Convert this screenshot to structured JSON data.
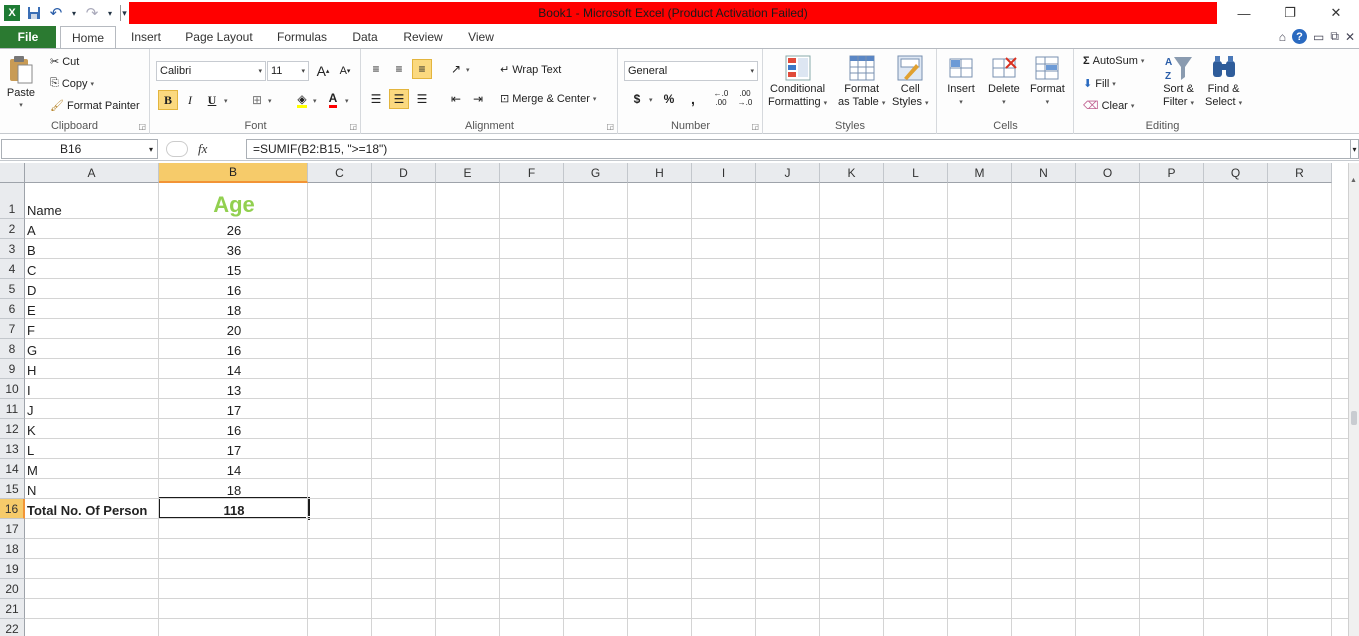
{
  "window": {
    "title": "Book1  -  Microsoft Excel (Product Activation Failed)",
    "minimize_glyph": "—",
    "restore_glyph": "❐",
    "close_glyph": "✕"
  },
  "qat": {
    "excel_logo": "X",
    "save_glyph": "💾",
    "undo_glyph": "↶",
    "redo_glyph": "↷",
    "customize_glyph": "▾"
  },
  "tabs": {
    "file": "File",
    "items": [
      "Home",
      "Insert",
      "Page Layout",
      "Formulas",
      "Data",
      "Review",
      "View"
    ],
    "active": "Home"
  },
  "ribbon": {
    "clipboard": {
      "label": "Clipboard",
      "paste": "Paste",
      "cut": "Cut",
      "copy": "Copy",
      "format_painter": "Format Painter"
    },
    "font": {
      "label": "Font",
      "font_name": "Calibri",
      "font_size": "11",
      "bold": "B",
      "italic": "I",
      "underline": "U",
      "grow": "A",
      "shrink": "A",
      "font_color_letter": "A"
    },
    "alignment": {
      "label": "Alignment",
      "wrap_text": "Wrap Text",
      "merge_center": "Merge & Center"
    },
    "number": {
      "label": "Number",
      "format": "General",
      "currency": "$",
      "percent": "%",
      "comma": ",",
      "inc_decimal_top": ".00",
      "inc_decimal_bottom": "←.0",
      "dec_decimal_top": ".00",
      "dec_decimal_bottom": "→.0"
    },
    "styles": {
      "label": "Styles",
      "conditional_1": "Conditional",
      "conditional_2": "Formatting",
      "format_table_1": "Format",
      "format_table_2": "as Table",
      "cell_styles_1": "Cell",
      "cell_styles_2": "Styles"
    },
    "cells": {
      "label": "Cells",
      "insert": "Insert",
      "delete": "Delete",
      "format": "Format"
    },
    "editing": {
      "label": "Editing",
      "autosum": "AutoSum",
      "fill": "Fill",
      "clear": "Clear",
      "sort_1": "Sort &",
      "sort_2": "Filter",
      "find_1": "Find &",
      "find_2": "Select"
    }
  },
  "formula_bar": {
    "name_box": "B16",
    "fx": "fx",
    "formula": "=SUMIF(B2:B15, \">=18\")"
  },
  "sheet": {
    "columns": [
      "A",
      "B",
      "C",
      "D",
      "E",
      "F",
      "G",
      "H",
      "I",
      "J",
      "K",
      "L",
      "M",
      "N",
      "O",
      "P",
      "Q",
      "R"
    ],
    "selected_column": "B",
    "selected_row": "16",
    "header_color": "#92d050",
    "rows": [
      {
        "n": "1",
        "a": "Name",
        "b": "Age"
      },
      {
        "n": "2",
        "a": "A",
        "b": "26"
      },
      {
        "n": "3",
        "a": "B",
        "b": "36"
      },
      {
        "n": "4",
        "a": "C",
        "b": "15"
      },
      {
        "n": "5",
        "a": "D",
        "b": "16"
      },
      {
        "n": "6",
        "a": "E",
        "b": "18"
      },
      {
        "n": "7",
        "a": "F",
        "b": "20"
      },
      {
        "n": "8",
        "a": "G",
        "b": "16"
      },
      {
        "n": "9",
        "a": "H",
        "b": "14"
      },
      {
        "n": "10",
        "a": "I",
        "b": "13"
      },
      {
        "n": "11",
        "a": "J",
        "b": "17"
      },
      {
        "n": "12",
        "a": "K",
        "b": "16"
      },
      {
        "n": "13",
        "a": "L",
        "b": "17"
      },
      {
        "n": "14",
        "a": "M",
        "b": "14"
      },
      {
        "n": "15",
        "a": "N",
        "b": "18"
      },
      {
        "n": "16",
        "a": "Total No. Of Person",
        "b": "118"
      },
      {
        "n": "17",
        "a": "",
        "b": ""
      },
      {
        "n": "18",
        "a": "",
        "b": ""
      },
      {
        "n": "19",
        "a": "",
        "b": ""
      },
      {
        "n": "20",
        "a": "",
        "b": ""
      },
      {
        "n": "21",
        "a": "",
        "b": ""
      },
      {
        "n": "22",
        "a": "",
        "b": ""
      }
    ]
  }
}
